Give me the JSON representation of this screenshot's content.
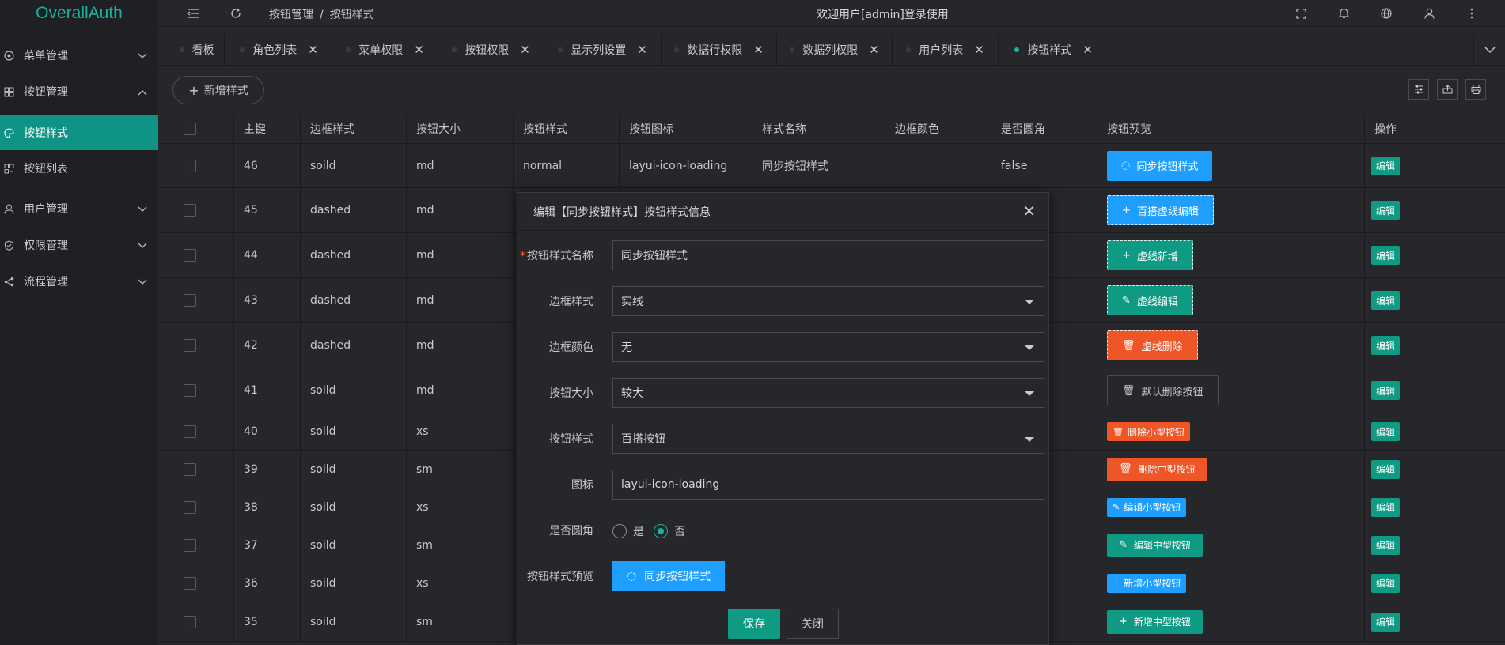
{
  "app": {
    "title": "OverallAuth"
  },
  "sidebar": {
    "items": [
      {
        "label": "菜单管理",
        "icon": "menu-icon"
      },
      {
        "label": "按钮管理",
        "icon": "grid-icon"
      },
      {
        "label": "按钮样式",
        "icon": "palette-icon"
      },
      {
        "label": "按钮列表",
        "icon": "list-icon"
      },
      {
        "label": "用户管理",
        "icon": "user-icon"
      },
      {
        "label": "权限管理",
        "icon": "shield-icon"
      },
      {
        "label": "流程管理",
        "icon": "share-icon"
      }
    ]
  },
  "header": {
    "breadcrumb": [
      "按钮管理",
      "按钮样式"
    ],
    "breadcrumb_sep": "/",
    "welcome": "欢迎用户[admin]登录使用"
  },
  "tabs": [
    {
      "label": "看板",
      "closable": false
    },
    {
      "label": "角色列表",
      "closable": true
    },
    {
      "label": "菜单权限",
      "closable": true
    },
    {
      "label": "按钮权限",
      "closable": true
    },
    {
      "label": "显示列设置",
      "closable": true
    },
    {
      "label": "数据行权限",
      "closable": true
    },
    {
      "label": "数据列权限",
      "closable": true
    },
    {
      "label": "用户列表",
      "closable": true
    },
    {
      "label": "按钮样式",
      "closable": true,
      "active": true
    }
  ],
  "toolbar": {
    "add_label": "新增样式"
  },
  "table": {
    "headers": [
      "主键",
      "边框样式",
      "按钮大小",
      "按钮样式",
      "按钮图标",
      "样式名称",
      "边框颜色",
      "是否圆角",
      "按钮预览",
      "操作"
    ],
    "rows": [
      {
        "id": "46",
        "border": "soild",
        "size": "md",
        "style": "normal",
        "icon": "layui-icon-loading",
        "name": "同步按钮样式",
        "color": "",
        "round": "false",
        "preview": "同步按钮样式",
        "action": "编辑"
      },
      {
        "id": "45",
        "border": "dashed",
        "size": "md",
        "preview": "百搭虚线编辑",
        "action": "编辑"
      },
      {
        "id": "44",
        "border": "dashed",
        "size": "md",
        "preview": "虚线新增",
        "action": "编辑"
      },
      {
        "id": "43",
        "border": "dashed",
        "size": "md",
        "preview": "虚线编辑",
        "action": "编辑"
      },
      {
        "id": "42",
        "border": "dashed",
        "size": "md",
        "preview": "虚线删除",
        "action": "编辑"
      },
      {
        "id": "41",
        "border": "soild",
        "size": "md",
        "preview": "默认删除按钮",
        "action": "编辑"
      },
      {
        "id": "40",
        "border": "soild",
        "size": "xs",
        "preview": "删除小型按钮",
        "action": "编辑"
      },
      {
        "id": "39",
        "border": "soild",
        "size": "sm",
        "preview": "删除中型按钮",
        "action": "编辑"
      },
      {
        "id": "38",
        "border": "soild",
        "size": "xs",
        "preview": "编辑小型按钮",
        "action": "编辑"
      },
      {
        "id": "37",
        "border": "soild",
        "size": "sm",
        "preview": "编辑中型按钮",
        "action": "编辑"
      },
      {
        "id": "36",
        "border": "soild",
        "size": "xs",
        "preview": "新增小型按钮",
        "action": "编辑"
      },
      {
        "id": "35",
        "border": "soild",
        "size": "sm",
        "preview": "新增中型按钮",
        "action": "编辑"
      }
    ]
  },
  "modal": {
    "title": "编辑【同步按钮样式】按钮样式信息",
    "fields": {
      "name_label": "按钮样式名称",
      "name_value": "同步按钮样式",
      "border_label": "边框样式",
      "border_value": "实线",
      "color_label": "边框颜色",
      "color_value": "无",
      "size_label": "按钮大小",
      "size_value": "较大",
      "style_label": "按钮样式",
      "style_value": "百搭按钮",
      "icon_label": "图标",
      "icon_value": "layui-icon-loading",
      "round_label": "是否圆角",
      "round_yes": "是",
      "round_no": "否",
      "round_selected": "否",
      "preview_label": "按钮样式预览",
      "preview_value": "同步按钮样式"
    },
    "save_label": "保存",
    "close_label": "关闭"
  },
  "colors": {
    "accent": "#0f9a84",
    "blue": "#1e9fff",
    "orange": "#ee5628"
  }
}
